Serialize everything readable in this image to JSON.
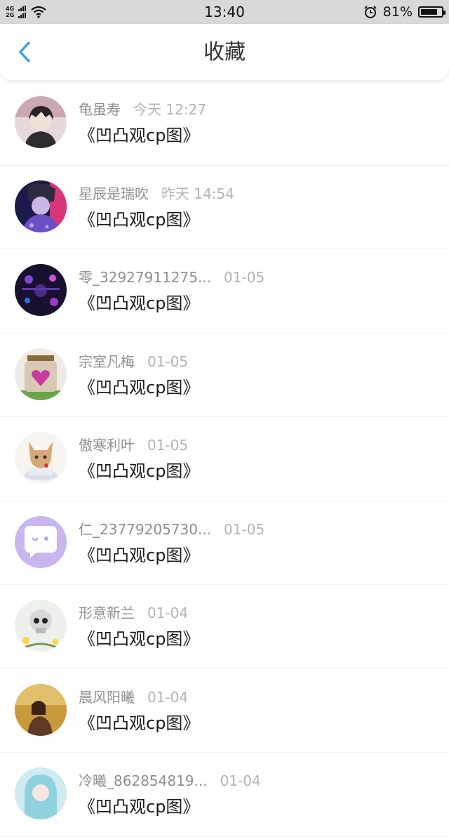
{
  "status_bar": {
    "network_top": "4G",
    "network_bottom": "2G",
    "time": "13:40",
    "battery_percent": "81%",
    "battery_level": 0.81,
    "icons": [
      "signal-icon",
      "wifi-icon",
      "alarm-icon",
      "battery-icon"
    ]
  },
  "header": {
    "title": "收藏",
    "back_icon": "chevron-left-icon",
    "accent_color": "#3a9be8"
  },
  "items": [
    {
      "name": "龟虽寿",
      "time": "今天 12:27",
      "title": "《凹凸观cp图》"
    },
    {
      "name": "星辰是瑞吹",
      "time": "昨天 14:54",
      "title": "《凹凸观cp图》"
    },
    {
      "name": "零_32927911275...",
      "time": "01-05",
      "title": "《凹凸观cp图》"
    },
    {
      "name": "宗室凡梅",
      "time": "01-05",
      "title": "《凹凸观cp图》"
    },
    {
      "name": "傲寒利叶",
      "time": "01-05",
      "title": "《凹凸观cp图》"
    },
    {
      "name": "仁_23779205730...",
      "time": "01-05",
      "title": "《凹凸观cp图》"
    },
    {
      "name": "形意新兰",
      "time": "01-04",
      "title": "《凹凸观cp图》"
    },
    {
      "name": "晨风阳曦",
      "time": "01-04",
      "title": "《凹凸观cp图》"
    },
    {
      "name": "冷曦_862854819...",
      "time": "01-04",
      "title": "《凹凸观cp图》"
    }
  ]
}
